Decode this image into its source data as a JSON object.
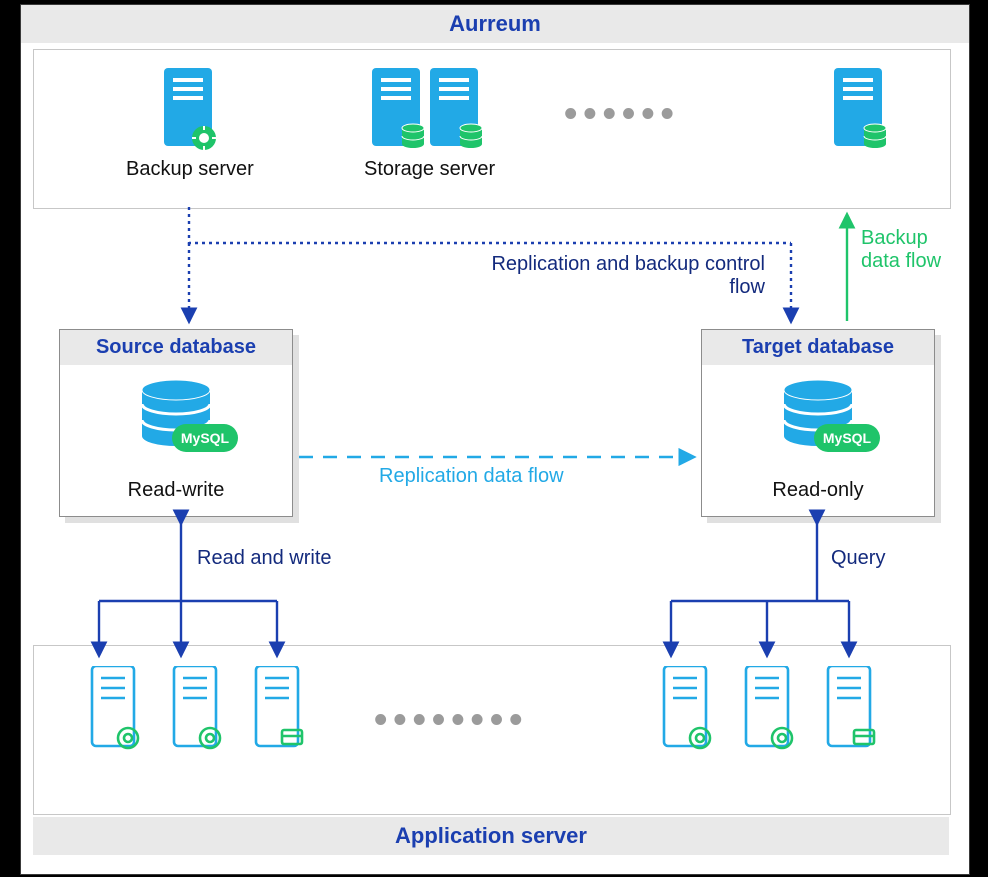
{
  "title_aurreum": "Aurreum",
  "backup_server_label": "Backup server",
  "storage_server_label": "Storage server",
  "source_db_title": "Source database",
  "target_db_title": "Target database",
  "source_db_mode": "Read-write",
  "target_db_mode": "Read-only",
  "mysql_badge": "MySQL",
  "flow_replication_backup_ctrl_1": "Replication and backup control",
  "flow_replication_backup_ctrl_2": "flow",
  "flow_backup_data_1": "Backup",
  "flow_backup_data_2": "data flow",
  "flow_replication_data": "Replication data flow",
  "flow_read_write": "Read and write",
  "flow_query": "Query",
  "title_appserver": "Application server",
  "colors": {
    "navy": "#1b3fb0",
    "dark_navy": "#132a7d",
    "cyan": "#22a9e6",
    "green": "#1fc46a",
    "grey": "#9b9b9b"
  }
}
